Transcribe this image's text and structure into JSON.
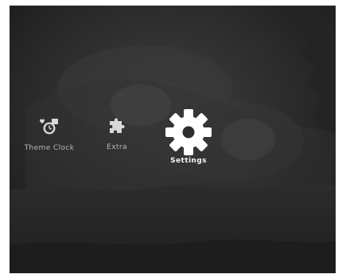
{
  "menu": {
    "items": [
      {
        "label": "Theme Clock",
        "icon": "clock-photo-icon",
        "selected": false
      },
      {
        "label": "Extra",
        "icon": "puzzle-icon",
        "selected": false
      },
      {
        "label": "Settings",
        "icon": "gear-icon",
        "selected": true
      }
    ]
  },
  "colors": {
    "label_inactive": "#b9b9b9",
    "label_active": "#f4f4f4",
    "icon_inactive": "#d8d8d8",
    "icon_active": "#ffffff"
  }
}
